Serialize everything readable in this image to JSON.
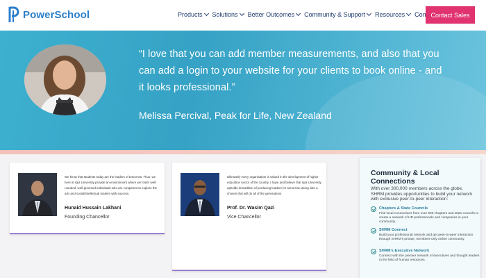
{
  "brand": {
    "name": "PowerSchool",
    "color": "#2b7fc9"
  },
  "nav": {
    "items": [
      {
        "label": "Products"
      },
      {
        "label": "Solutions"
      },
      {
        "label": "Better Outcomes"
      },
      {
        "label": "Community & Support"
      },
      {
        "label": "Resources"
      },
      {
        "label": "Company"
      }
    ],
    "contact_label": "Contact Sales",
    "contact_color": "#e0336f"
  },
  "hero": {
    "quote": "“I love that you can add member measurements, and also that you can add a login to your website for your clients to book online - and it looks professional.”",
    "attribution": "Melissa Percival, Peak for Life, New Zealand"
  },
  "people": [
    {
      "blurb": "We know that students today are the leaders of tomorrow. Thus, we here at Iqra University provide an environment where we foster well-rounded, well-groomed individuals who are competent to explore the arts and social/intellectual matters with success.",
      "name": "Hunaid Hussain Lakhani",
      "title": "Founding Chancellor"
    },
    {
      "blurb": "Ultimately every organisation is valued in the development of higher education sector of the country. I hope and believe that Iqra University upholds its tradition of producing leaders for tomorrow, along side a chosen that will do all of the generations.",
      "name": "Prof. Dr. Wasim Qazi",
      "title": "Vice Chancellor"
    }
  ],
  "community": {
    "title": "Community & Local Connections",
    "intro": "With over 300,000 members across the globe, SHRM provides opportunities to build your network with exclusive peer-to-peer interaction:",
    "items": [
      {
        "heading": "Chapters & State Councils",
        "desc": "Find local connections from over 600 chapters and state councils to create a network of HR professionals and companies in your community."
      },
      {
        "heading": "SHRM Connect",
        "desc": "Build your professional network and get peer-to-peer interaction through SHRM's private, members-only online community."
      },
      {
        "heading": "SHRM's Executive Network",
        "desc": "Connect with the premier network of executives and thought leaders in the field of human resources."
      }
    ]
  }
}
